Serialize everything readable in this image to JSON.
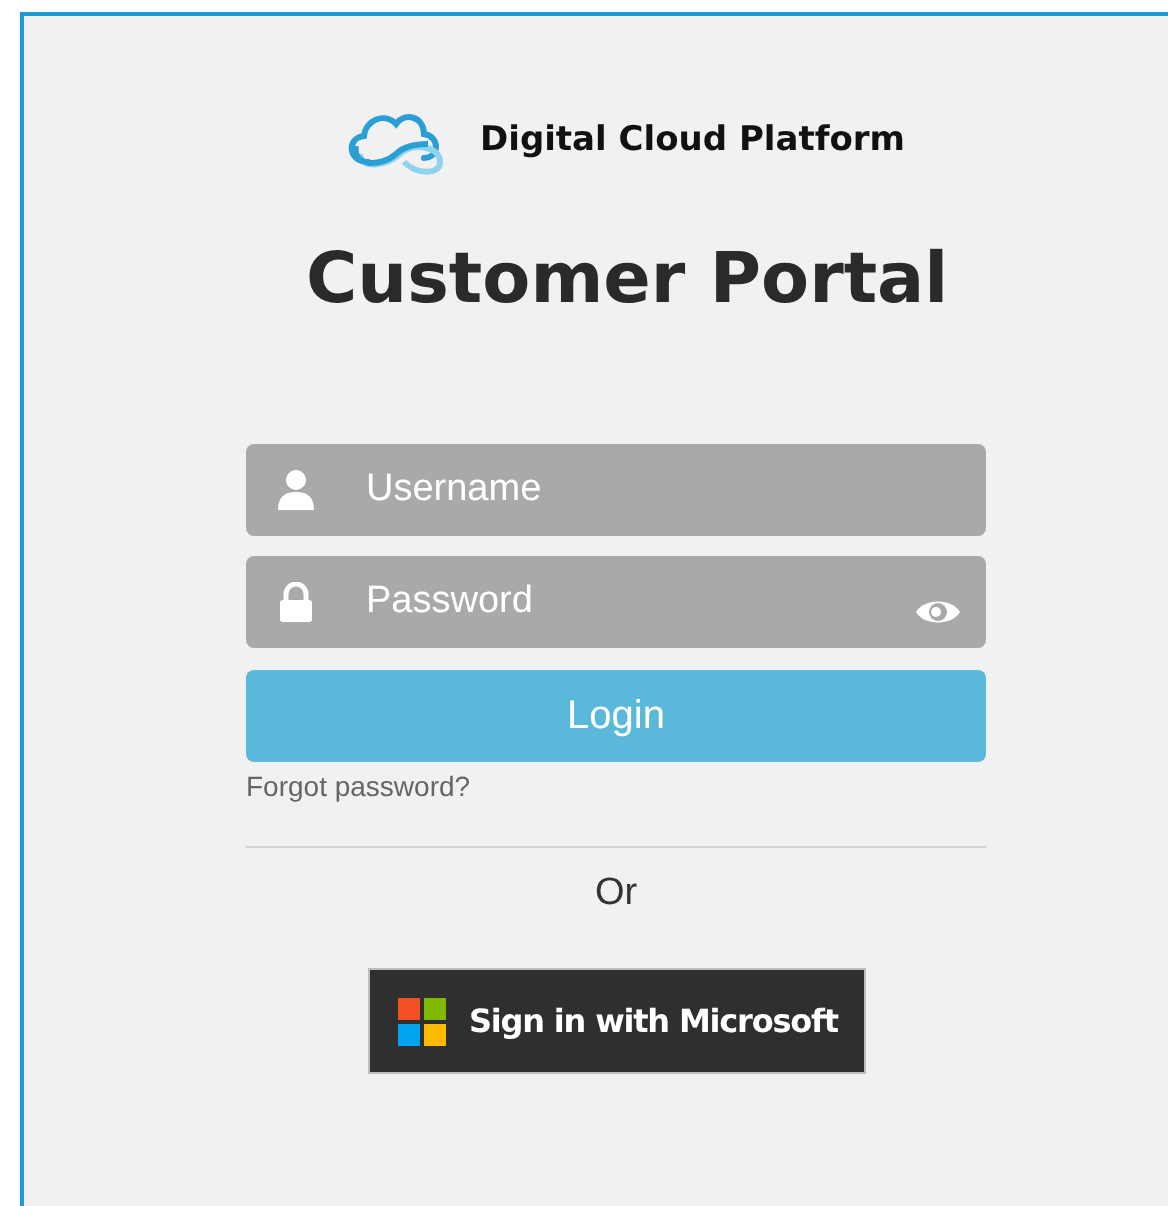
{
  "brand": {
    "name": "Digital Cloud Platform"
  },
  "title": "Customer Portal",
  "fields": [
    {
      "kind": "user",
      "placeholder": "Username"
    },
    {
      "kind": "password",
      "placeholder": "Password"
    }
  ],
  "login_button": "Login",
  "forgot_link": "Forgot password?",
  "separator": "Or",
  "microsoft_button": "Sign in with Microsoft"
}
